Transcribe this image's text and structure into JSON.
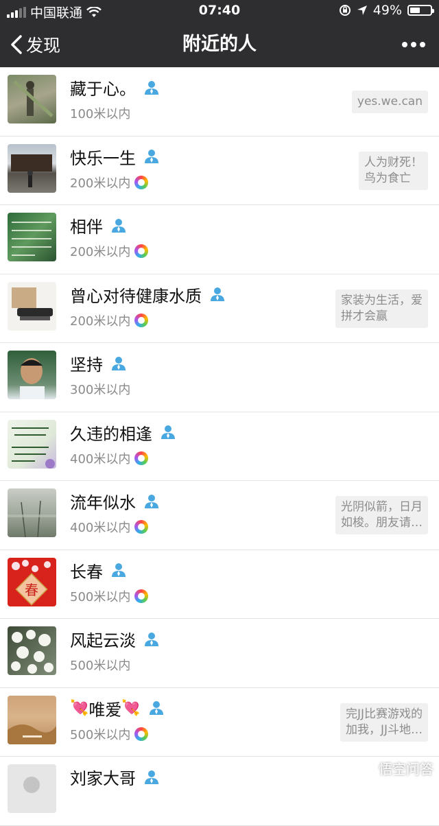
{
  "status_bar": {
    "carrier": "中国联通",
    "time": "07:40",
    "battery": "49%",
    "battery_level": 0.49
  },
  "nav": {
    "back_label": "发现",
    "title": "附近的人"
  },
  "people": [
    {
      "name": "藏于心。",
      "distance": "100米以内",
      "signature": "yes.we.can",
      "has_moments": false
    },
    {
      "name": "快乐一生",
      "distance": "200米以内",
      "signature": "人为财死！\n鸟为食亡",
      "has_moments": true
    },
    {
      "name": "相伴",
      "distance": "200米以内",
      "signature": "",
      "has_moments": true
    },
    {
      "name": "曾心对待健康水质",
      "distance": "200米以内",
      "signature": "家装为生活，爱\n拼才会赢",
      "has_moments": true
    },
    {
      "name": "坚持",
      "distance": "300米以内",
      "signature": "",
      "has_moments": false
    },
    {
      "name": "久违的相逢",
      "distance": "400米以内",
      "signature": "",
      "has_moments": true
    },
    {
      "name": "流年似水",
      "distance": "400米以内",
      "signature": "光阴似箭，日月\n如梭。朋友请…",
      "has_moments": true
    },
    {
      "name": "长春",
      "distance": "500米以内",
      "signature": "",
      "has_moments": true
    },
    {
      "name": "风起云淡",
      "distance": "500米以内",
      "signature": "",
      "has_moments": false
    },
    {
      "name": "唯爱",
      "distance": "500米以内",
      "signature": "完JJ比赛游戏的\n加我，JJ斗地…",
      "has_moments": true
    },
    {
      "name": "刘家大哥",
      "distance": "",
      "signature": "",
      "has_moments": false
    }
  ],
  "avatar_texts": {
    "spring_char": "春"
  },
  "watermark": "悟空问答",
  "colors": {
    "nav_bg": "#2e2e31",
    "person_icon": "#4aa8e0"
  }
}
